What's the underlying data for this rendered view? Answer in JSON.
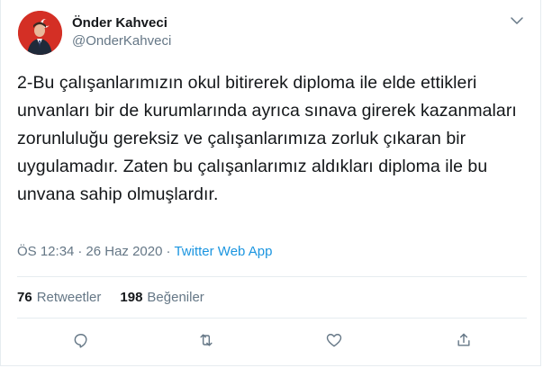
{
  "user": {
    "display_name": "Önder Kahveci",
    "handle": "@OnderKahveci"
  },
  "tweet": {
    "text": "2-Bu çalışanlarımızın okul bitirerek diploma ile elde ettikleri unvanları bir de kurumlarında ayrıca sınava girerek kazanmaları zorunluluğu gereksiz ve çalışanlarımıza zorluk çıkaran bir uygulamadır. Zaten bu çalışanlarımız aldıkları diploma ile bu unvana sahip olmuşlardır."
  },
  "meta": {
    "time": "ÖS 12:34",
    "separator": "·",
    "date": "26 Haz 2020",
    "source": "Twitter Web App"
  },
  "stats": {
    "retweets_count": "76",
    "retweets_label": "Retweetler",
    "likes_count": "198",
    "likes_label": "Beğeniler"
  },
  "icons": {
    "caret": "chevron-down-icon",
    "reply": "reply-icon",
    "retweet": "retweet-icon",
    "like": "heart-icon",
    "share": "share-icon"
  },
  "colors": {
    "link": "#1b95e0",
    "muted": "#657786",
    "text": "#14171a",
    "divider": "#e6ecf0"
  }
}
